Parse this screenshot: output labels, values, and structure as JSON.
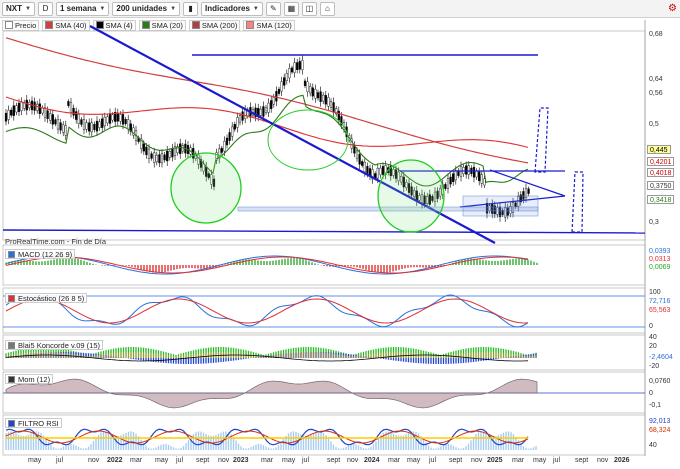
{
  "toolbar": {
    "symbol": "NXT",
    "d_label": "D",
    "period": "1 semana",
    "units": "200 unidades",
    "indicators": "Indicadores"
  },
  "legend": {
    "items": [
      {
        "label": "Precio",
        "color": "#ffffff"
      },
      {
        "label": "SMA (40)",
        "color": "#d04040"
      },
      {
        "label": "SMA (4)",
        "color": "#000000"
      },
      {
        "label": "SMA (20)",
        "color": "#2d7a1a"
      },
      {
        "label": "SMA (200)",
        "color": "#b04040"
      },
      {
        "label": "SMA (120)",
        "color": "#ff8080"
      }
    ]
  },
  "price_axis": [
    "0,68",
    "0,64",
    "0,56",
    "0,5",
    "0,3"
  ],
  "price_badges": [
    {
      "text": "0,445",
      "bg": "#ffff99",
      "color": "#000000"
    },
    {
      "text": "0,4201",
      "bg": "#ffffff",
      "color": "#cc0000"
    },
    {
      "text": "0,4018",
      "bg": "#ffffff",
      "color": "#cc0000"
    },
    {
      "text": "0,3750",
      "bg": "#ffffff",
      "color": "#333333"
    },
    {
      "text": "0,3418",
      "bg": "#ffffff",
      "color": "#2d7a1a"
    }
  ],
  "watermark": "ProRealTime.com - Fin de Día",
  "panels": {
    "macd": {
      "title": "MACD (12 26 9)",
      "values": [
        "0,0393",
        "0,0313",
        "0,0069"
      ],
      "colors": [
        "#2a6fdb",
        "#e03030",
        "#22aa22"
      ]
    },
    "stoch": {
      "title": "Estocástico (26 8 5)",
      "axis": [
        "100",
        "72,716",
        "65,563",
        "0"
      ]
    },
    "blai5": {
      "title": "Blai5 Koncorde v.09 (15)",
      "axis": [
        "40",
        "20",
        "-2,4604",
        "-20"
      ]
    },
    "mom": {
      "title": "Mom (12)",
      "axis": [
        "0,0760",
        "0",
        "-0,1"
      ]
    },
    "rsi": {
      "title": "FILTRO RSI",
      "axis": [
        "92,013",
        "68,324",
        "40"
      ]
    }
  },
  "xaxis": [
    {
      "label": "may",
      "year": false
    },
    {
      "label": "jul",
      "year": false
    },
    {
      "label": "nov",
      "year": false
    },
    {
      "label": "2022",
      "year": true
    },
    {
      "label": "mar",
      "year": false
    },
    {
      "label": "may",
      "year": false
    },
    {
      "label": "jul",
      "year": false
    },
    {
      "label": "sept",
      "year": false
    },
    {
      "label": "nov",
      "year": false
    },
    {
      "label": "2023",
      "year": true
    },
    {
      "label": "mar",
      "year": false
    },
    {
      "label": "may",
      "year": false
    },
    {
      "label": "jul",
      "year": false
    },
    {
      "label": "sept",
      "year": false
    },
    {
      "label": "nov",
      "year": false
    },
    {
      "label": "2024",
      "year": true
    },
    {
      "label": "mar",
      "year": false
    },
    {
      "label": "may",
      "year": false
    },
    {
      "label": "jul",
      "year": false
    },
    {
      "label": "sept",
      "year": false
    },
    {
      "label": "nov",
      "year": false
    },
    {
      "label": "2025",
      "year": true
    },
    {
      "label": "mar",
      "year": false
    },
    {
      "label": "may",
      "year": false
    },
    {
      "label": "jul",
      "year": false
    },
    {
      "label": "sept",
      "year": false
    },
    {
      "label": "nov",
      "year": false
    },
    {
      "label": "2026",
      "year": true
    }
  ]
}
